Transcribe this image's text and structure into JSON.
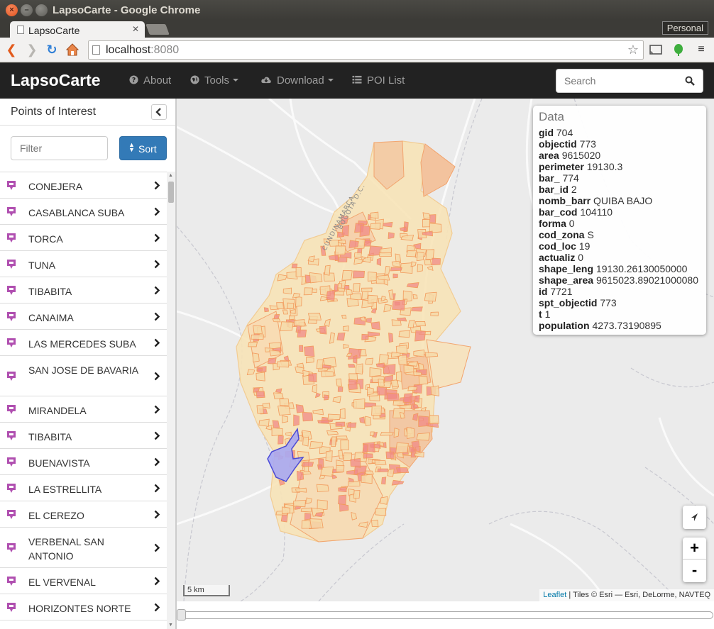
{
  "window": {
    "title": "LapsoCarte - Google Chrome",
    "tab_title": "LapsoCarte",
    "profile": "Personal"
  },
  "browser": {
    "url_host": "localhost",
    "url_port": ":8080"
  },
  "navbar": {
    "brand": "LapsoCarte",
    "items": [
      {
        "label": "About",
        "icon": "question-circle-icon",
        "dropdown": false
      },
      {
        "label": "Tools",
        "icon": "globe-icon",
        "dropdown": true
      },
      {
        "label": "Download",
        "icon": "cloud-download-icon",
        "dropdown": true
      },
      {
        "label": "POI List",
        "icon": "list-icon",
        "dropdown": false
      }
    ],
    "search_placeholder": "Search"
  },
  "sidebar": {
    "title": "Points of Interest",
    "filter_placeholder": "Filter",
    "sort_label": "Sort",
    "items": [
      {
        "name": "CONEJERA",
        "lines": 1
      },
      {
        "name": "CASABLANCA SUBA",
        "lines": 1
      },
      {
        "name": "TORCA",
        "lines": 1
      },
      {
        "name": "TUNA",
        "lines": 1
      },
      {
        "name": "TIBABITA",
        "lines": 1
      },
      {
        "name": "CANAIMA",
        "lines": 1
      },
      {
        "name": "LAS MERCEDES SUBA",
        "lines": 1
      },
      {
        "name": "SAN JOSE DE BAVARIA",
        "lines": 2
      },
      {
        "name": "MIRANDELA",
        "lines": 1
      },
      {
        "name": "TIBABITA",
        "lines": 1
      },
      {
        "name": "BUENAVISTA",
        "lines": 1
      },
      {
        "name": "LA ESTRELLITA",
        "lines": 1
      },
      {
        "name": "EL CEREZO",
        "lines": 1
      },
      {
        "name": "VERBENAL SAN ANTONIO",
        "lines": 2
      },
      {
        "name": "EL VERVENAL",
        "lines": 1
      },
      {
        "name": "HORIZONTES NORTE",
        "lines": 1
      }
    ]
  },
  "data_panel": {
    "title": "Data",
    "fields": [
      {
        "key": "gid",
        "value": "704"
      },
      {
        "key": "objectid",
        "value": "773"
      },
      {
        "key": "area",
        "value": "9615020"
      },
      {
        "key": "perimeter",
        "value": "19130.3"
      },
      {
        "key": "bar_",
        "value": "774"
      },
      {
        "key": "bar_id",
        "value": "2"
      },
      {
        "key": "nomb_barr",
        "value": "QUIBA BAJO"
      },
      {
        "key": "bar_cod",
        "value": "104110"
      },
      {
        "key": "forma",
        "value": "0"
      },
      {
        "key": "cod_zona",
        "value": "S"
      },
      {
        "key": "cod_loc",
        "value": "19"
      },
      {
        "key": "actualiz",
        "value": "0"
      },
      {
        "key": "shape_leng",
        "value": "19130.26130050000"
      },
      {
        "key": "shape_area",
        "value": "9615023.89021000080"
      },
      {
        "key": "id",
        "value": "7721"
      },
      {
        "key": "spt_objectid",
        "value": "773"
      },
      {
        "key": "t",
        "value": "1"
      },
      {
        "key": "population",
        "value": "4273.73190895"
      }
    ]
  },
  "map": {
    "labels": [
      "CUNDINAMARCA",
      "BOGOTA D.C."
    ],
    "scale": "5 km",
    "attribution_link": "Leaflet",
    "attribution_text": " | Tiles © Esri — Esri, DeLorme, NAVTEQ",
    "zoom_in": "+",
    "zoom_out": "-",
    "colors": {
      "choropleth_fill": "#f6d9a8",
      "choropleth_edge": "#f29a5c",
      "dense_cell": "#f08a86",
      "selected": "#9c9cf0",
      "selected_edge": "#3b3bd6"
    }
  },
  "time_slider": {
    "value": 0
  }
}
